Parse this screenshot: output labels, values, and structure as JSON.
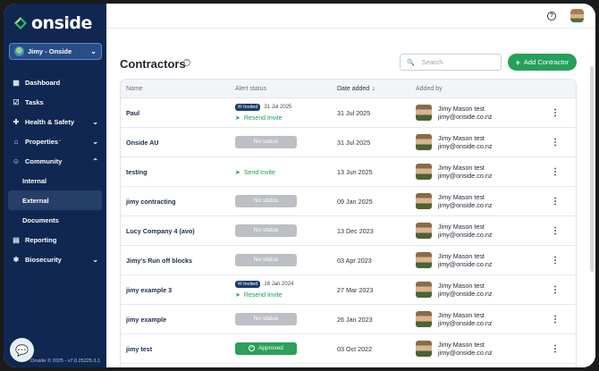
{
  "app": {
    "logo_text": "onside"
  },
  "org_select": {
    "label": "Jimy - Onside"
  },
  "nav": {
    "dashboard": "Dashboard",
    "tasks": "Tasks",
    "health_safety": "Health & Safety",
    "properties": "Properties",
    "properties_badge": "•",
    "community": "Community",
    "internal": "Internal",
    "external": "External",
    "documents": "Documents",
    "reporting": "Reporting",
    "biosecurity": "Biosecurity"
  },
  "footer": {
    "version": "Onside © 2025 - v7.0.25225.3.1"
  },
  "page": {
    "title": "Contractors"
  },
  "search": {
    "placeholder": "Search"
  },
  "add_button": {
    "label": "Add Contractor"
  },
  "table": {
    "headers": {
      "name": "Name",
      "alert": "Alert status",
      "date": "Date added",
      "added_by": "Added by"
    },
    "rows": [
      {
        "name": "Paul",
        "alert_type": "invited",
        "invited_badge": "Invited",
        "invited_date": "31 Jul 2025",
        "action": "Resend Invite",
        "date": "31 Jul 2025",
        "person": "Jimy Mason test",
        "email": "jimy@onside.co.nz"
      },
      {
        "name": "Onside AU",
        "alert_type": "none",
        "status": "No status",
        "date": "31 Jul 2025",
        "person": "Jimy Mason test",
        "email": "jimy@onside.co.nz"
      },
      {
        "name": "testing",
        "alert_type": "send",
        "action": "Send Invite",
        "date": "13 Jun 2025",
        "person": "Jimy Mason test",
        "email": "jimy@onside.co.nz"
      },
      {
        "name": "jimy contracting",
        "alert_type": "none",
        "status": "No status",
        "date": "09 Jan 2025",
        "person": "Jimy Mason test",
        "email": "jimy@onside.co.nz"
      },
      {
        "name": "Lucy Company 4 (avo)",
        "alert_type": "none",
        "status": "No status",
        "date": "13 Dec 2023",
        "person": "Jimy Mason test",
        "email": "jimy@onside.co.nz"
      },
      {
        "name": "Jimy's Run off blocks",
        "alert_type": "none",
        "status": "No status",
        "date": "03 Apr 2023",
        "person": "Jimy Mason test",
        "email": "jimy@onside.co.nz"
      },
      {
        "name": "jimy example 3",
        "alert_type": "invited",
        "invited_badge": "Invited",
        "invited_date": "16 Jan 2024",
        "action": "Resend Invite",
        "date": "27 Mar 2023",
        "person": "Jimy Mason test",
        "email": "jimy@onside.co.nz"
      },
      {
        "name": "jimy example",
        "alert_type": "none",
        "status": "No status",
        "date": "26 Jan 2023",
        "person": "Jimy Mason test",
        "email": "jimy@onside.co.nz"
      },
      {
        "name": "jimy test",
        "alert_type": "approved",
        "status": "Approved",
        "date": "03 Oct 2022",
        "person": "Jimy Mason test",
        "email": "jimy@onside.co.nz"
      }
    ]
  },
  "colors": {
    "sidebar": "#0f2751",
    "accent": "#25a05a",
    "invited_badge": "#1e3a68"
  }
}
